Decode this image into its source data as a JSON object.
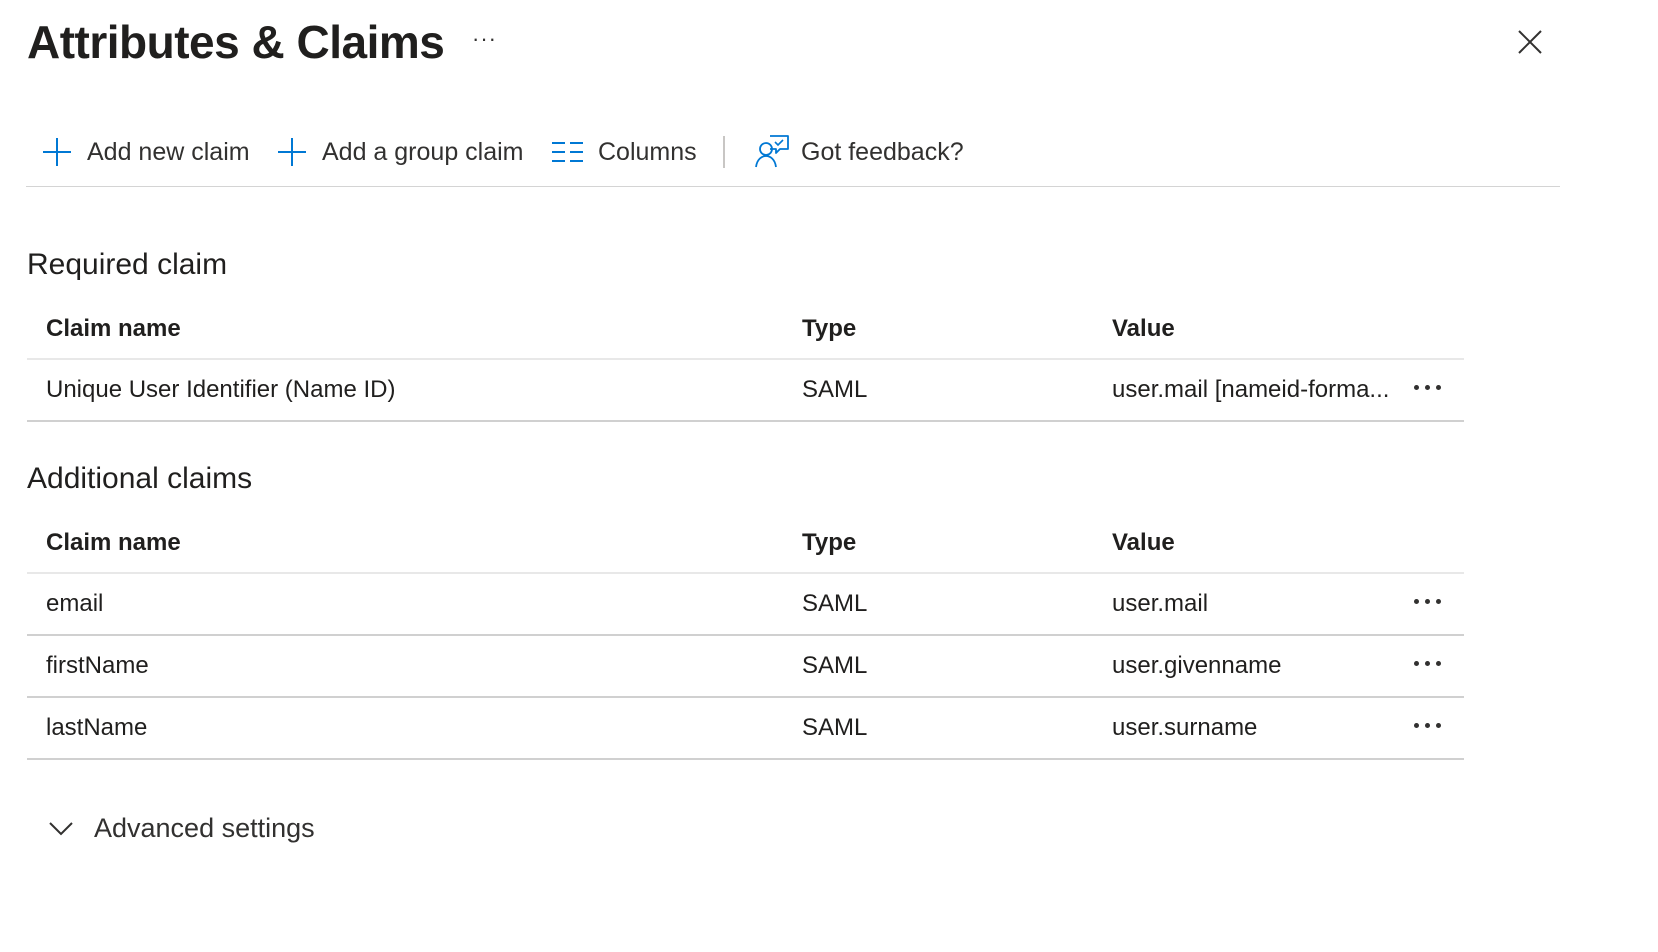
{
  "header": {
    "title": "Attributes & Claims",
    "more": "···"
  },
  "toolbar": {
    "add_new_claim": "Add new claim",
    "add_group_claim": "Add a group claim",
    "columns": "Columns",
    "feedback": "Got feedback?"
  },
  "required": {
    "title": "Required claim",
    "columns": {
      "name": "Claim name",
      "type": "Type",
      "value": "Value"
    },
    "rows": [
      {
        "name": "Unique User Identifier (Name ID)",
        "type": "SAML",
        "value": "user.mail [nameid-forma..."
      }
    ]
  },
  "additional": {
    "title": "Additional claims",
    "columns": {
      "name": "Claim name",
      "type": "Type",
      "value": "Value"
    },
    "rows": [
      {
        "name": "email",
        "type": "SAML",
        "value": "user.mail"
      },
      {
        "name": "firstName",
        "type": "SAML",
        "value": "user.givenname"
      },
      {
        "name": "lastName",
        "type": "SAML",
        "value": "user.surname"
      }
    ]
  },
  "advanced": {
    "label": "Advanced settings"
  },
  "colors": {
    "accent": "#0078d4",
    "text": "#201f1e",
    "divider": "#d0d0d0"
  }
}
